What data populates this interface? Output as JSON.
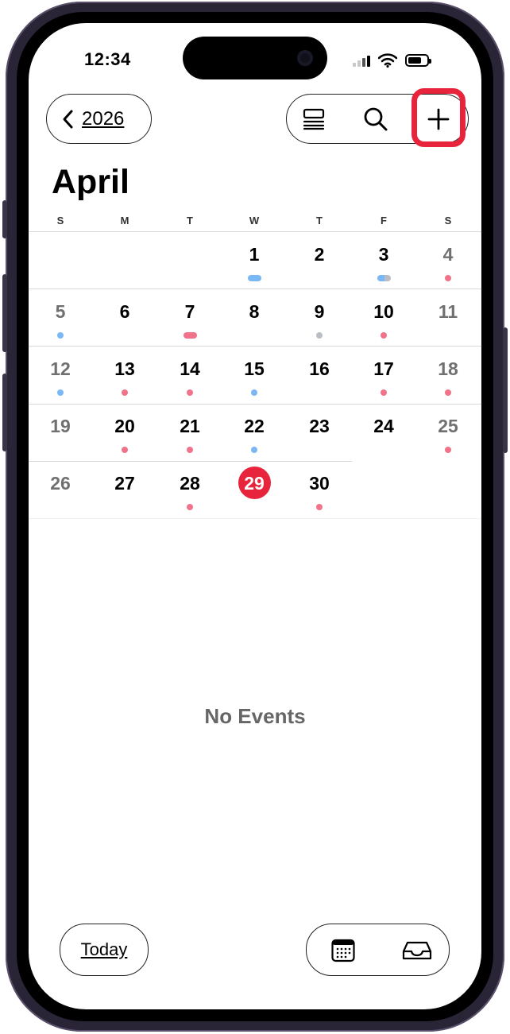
{
  "status": {
    "time": "12:34"
  },
  "nav": {
    "back_label": "2026"
  },
  "toolbar": {
    "list_icon": "list-view-icon",
    "search_icon": "search-icon",
    "add_icon": "plus-icon"
  },
  "calendar": {
    "month": "April",
    "weekdays": [
      "S",
      "M",
      "T",
      "W",
      "T",
      "F",
      "S"
    ],
    "days": [
      "1",
      "2",
      "3",
      "4",
      "5",
      "6",
      "7",
      "8",
      "9",
      "10",
      "11",
      "12",
      "13",
      "14",
      "15",
      "16",
      "17",
      "18",
      "19",
      "20",
      "21",
      "22",
      "23",
      "24",
      "25",
      "26",
      "27",
      "28",
      "29",
      "30"
    ],
    "today": "29"
  },
  "events": {
    "empty_text": "No Events"
  },
  "bottom": {
    "today_label": "Today",
    "calendar_icon": "calendar-grid-icon",
    "inbox_icon": "inbox-tray-icon"
  },
  "colors": {
    "accent": "#e8233c",
    "blue_dot": "#7ab8f5",
    "pink_dot": "#f0738a",
    "gray_dot": "#b9bec6"
  }
}
